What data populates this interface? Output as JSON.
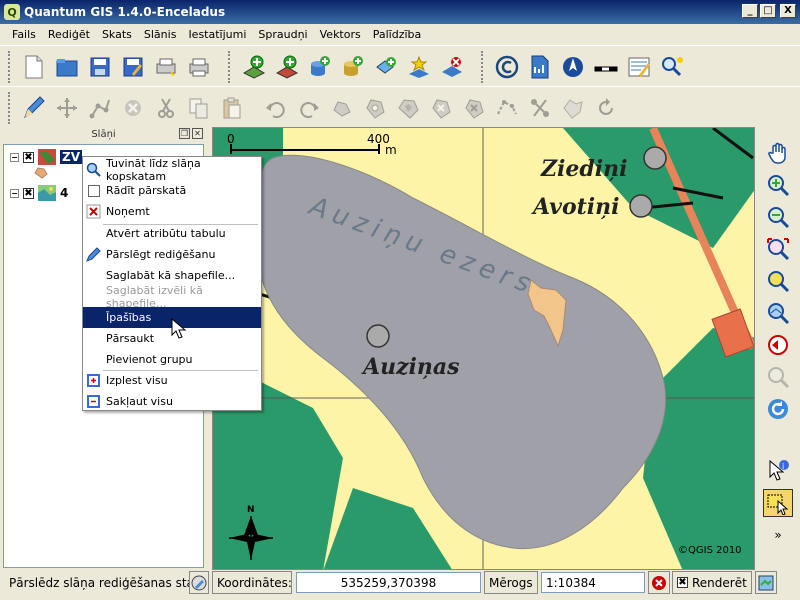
{
  "window": {
    "title": "Quantum GIS 1.4.0-Enceladus",
    "app_icon": "Q",
    "minimize": "_",
    "maximize": "□",
    "close": "X"
  },
  "menu": [
    "Fails",
    "Rediģēt",
    "Skats",
    "Slānis",
    "Iestatījumi",
    "Spraudņi",
    "Vektors",
    "Palīdzība"
  ],
  "dock": {
    "title": "Slāņi",
    "layers": [
      {
        "label": "ZV",
        "checked": "✖",
        "expand": "−"
      },
      {
        "label": "4",
        "checked": "✖",
        "expand": "−"
      }
    ]
  },
  "context_menu": [
    {
      "label": "Tuvināt līdz slāņa kopskatam",
      "icon": "zoom-layer-icon",
      "glyph": "🔍",
      "enabled": true
    },
    {
      "label": "Rādīt pārskatā",
      "icon": "overview-checkbox-icon",
      "glyph": "☐",
      "enabled": true
    },
    {
      "label": "Noņemt",
      "icon": "remove-icon",
      "glyph": "✖",
      "enabled": true
    },
    {
      "label": "Atvērt atribūtu tabulu",
      "icon": "",
      "glyph": "",
      "enabled": true
    },
    {
      "label": "Pārslēgt rediģēšanu",
      "icon": "pencil-icon",
      "glyph": "✏",
      "enabled": true
    },
    {
      "label": "Saglabāt kā shapefile...",
      "icon": "",
      "glyph": "",
      "enabled": true
    },
    {
      "label": "Saglabāt izvēli kā shapefile...",
      "icon": "",
      "glyph": "",
      "enabled": false
    },
    {
      "label": "Īpašības",
      "icon": "",
      "glyph": "",
      "enabled": true,
      "selected": true
    },
    {
      "label": "Pārsaukt",
      "icon": "",
      "glyph": "",
      "enabled": true
    },
    {
      "label": "Pievienot grupu",
      "icon": "",
      "glyph": "",
      "enabled": true
    },
    {
      "label": "Izplest visu",
      "icon": "expand-all-icon",
      "glyph": "⊞",
      "enabled": true
    },
    {
      "label": "Sakļaut visu",
      "icon": "collapse-all-icon",
      "glyph": "⊟",
      "enabled": true
    }
  ],
  "map": {
    "scalebar_start": "0",
    "scalebar_end": "400",
    "scalebar_unit": "m",
    "labels": {
      "ziedini": "Ziediņi",
      "avotini": "Avotiņi",
      "lake": "Auziņu ezers",
      "auzinas": "Auziņas"
    },
    "copyright": "©QGIS 2010",
    "north": "N"
  },
  "status": {
    "message": "Pārslēdz slāņa rediģēšanas stat",
    "coord_label": "Koordinātes:",
    "coords": "535259,370398",
    "scale_label": "Mērogs",
    "scale": "1:10384",
    "render_label": "Renderēt",
    "render_checked": "✖"
  },
  "colors": {
    "selection": "#0a246a",
    "lake": "#a0a0a8",
    "forest": "#2a9a6a",
    "field": "#fef4a8"
  }
}
